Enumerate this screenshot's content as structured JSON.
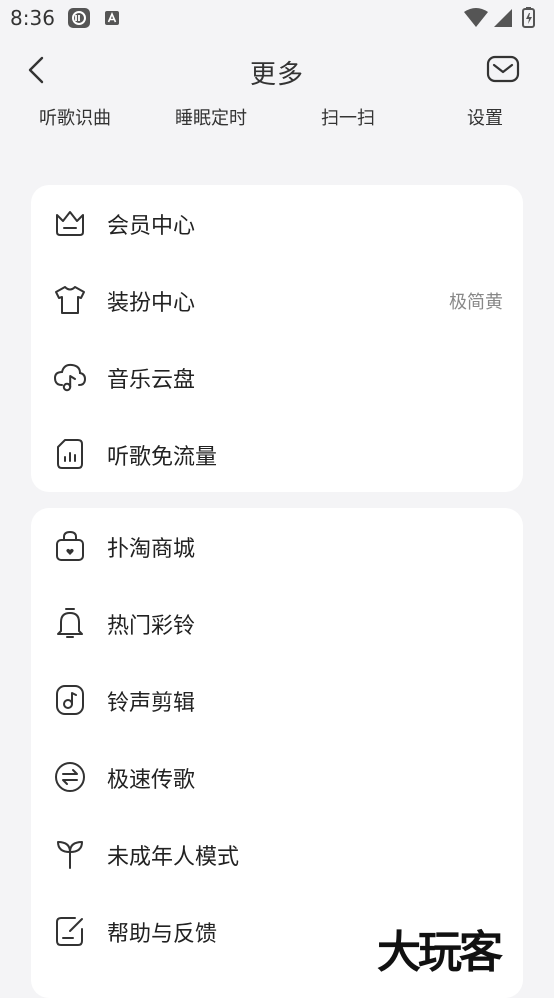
{
  "status": {
    "time": "8:36"
  },
  "header": {
    "title": "更多"
  },
  "quick_actions": [
    {
      "label": "听歌识曲"
    },
    {
      "label": "睡眠定时"
    },
    {
      "label": "扫一扫"
    },
    {
      "label": "设置"
    }
  ],
  "card1": {
    "items": [
      {
        "label": "会员中心",
        "icon": "crown-icon"
      },
      {
        "label": "装扮中心",
        "icon": "shirt-icon",
        "value": "极简黄"
      },
      {
        "label": "音乐云盘",
        "icon": "cloud-music-icon"
      },
      {
        "label": "听歌免流量",
        "icon": "sim-data-icon"
      }
    ]
  },
  "card2": {
    "items": [
      {
        "label": "扑淘商城",
        "icon": "shopping-bag-icon"
      },
      {
        "label": "热门彩铃",
        "icon": "bell-icon"
      },
      {
        "label": "铃声剪辑",
        "icon": "music-note-icon"
      },
      {
        "label": "极速传歌",
        "icon": "transfer-icon"
      },
      {
        "label": "未成年人模式",
        "icon": "sprout-icon"
      },
      {
        "label": "帮助与反馈",
        "icon": "feedback-icon"
      }
    ]
  },
  "watermark": {
    "text": "大玩客"
  }
}
